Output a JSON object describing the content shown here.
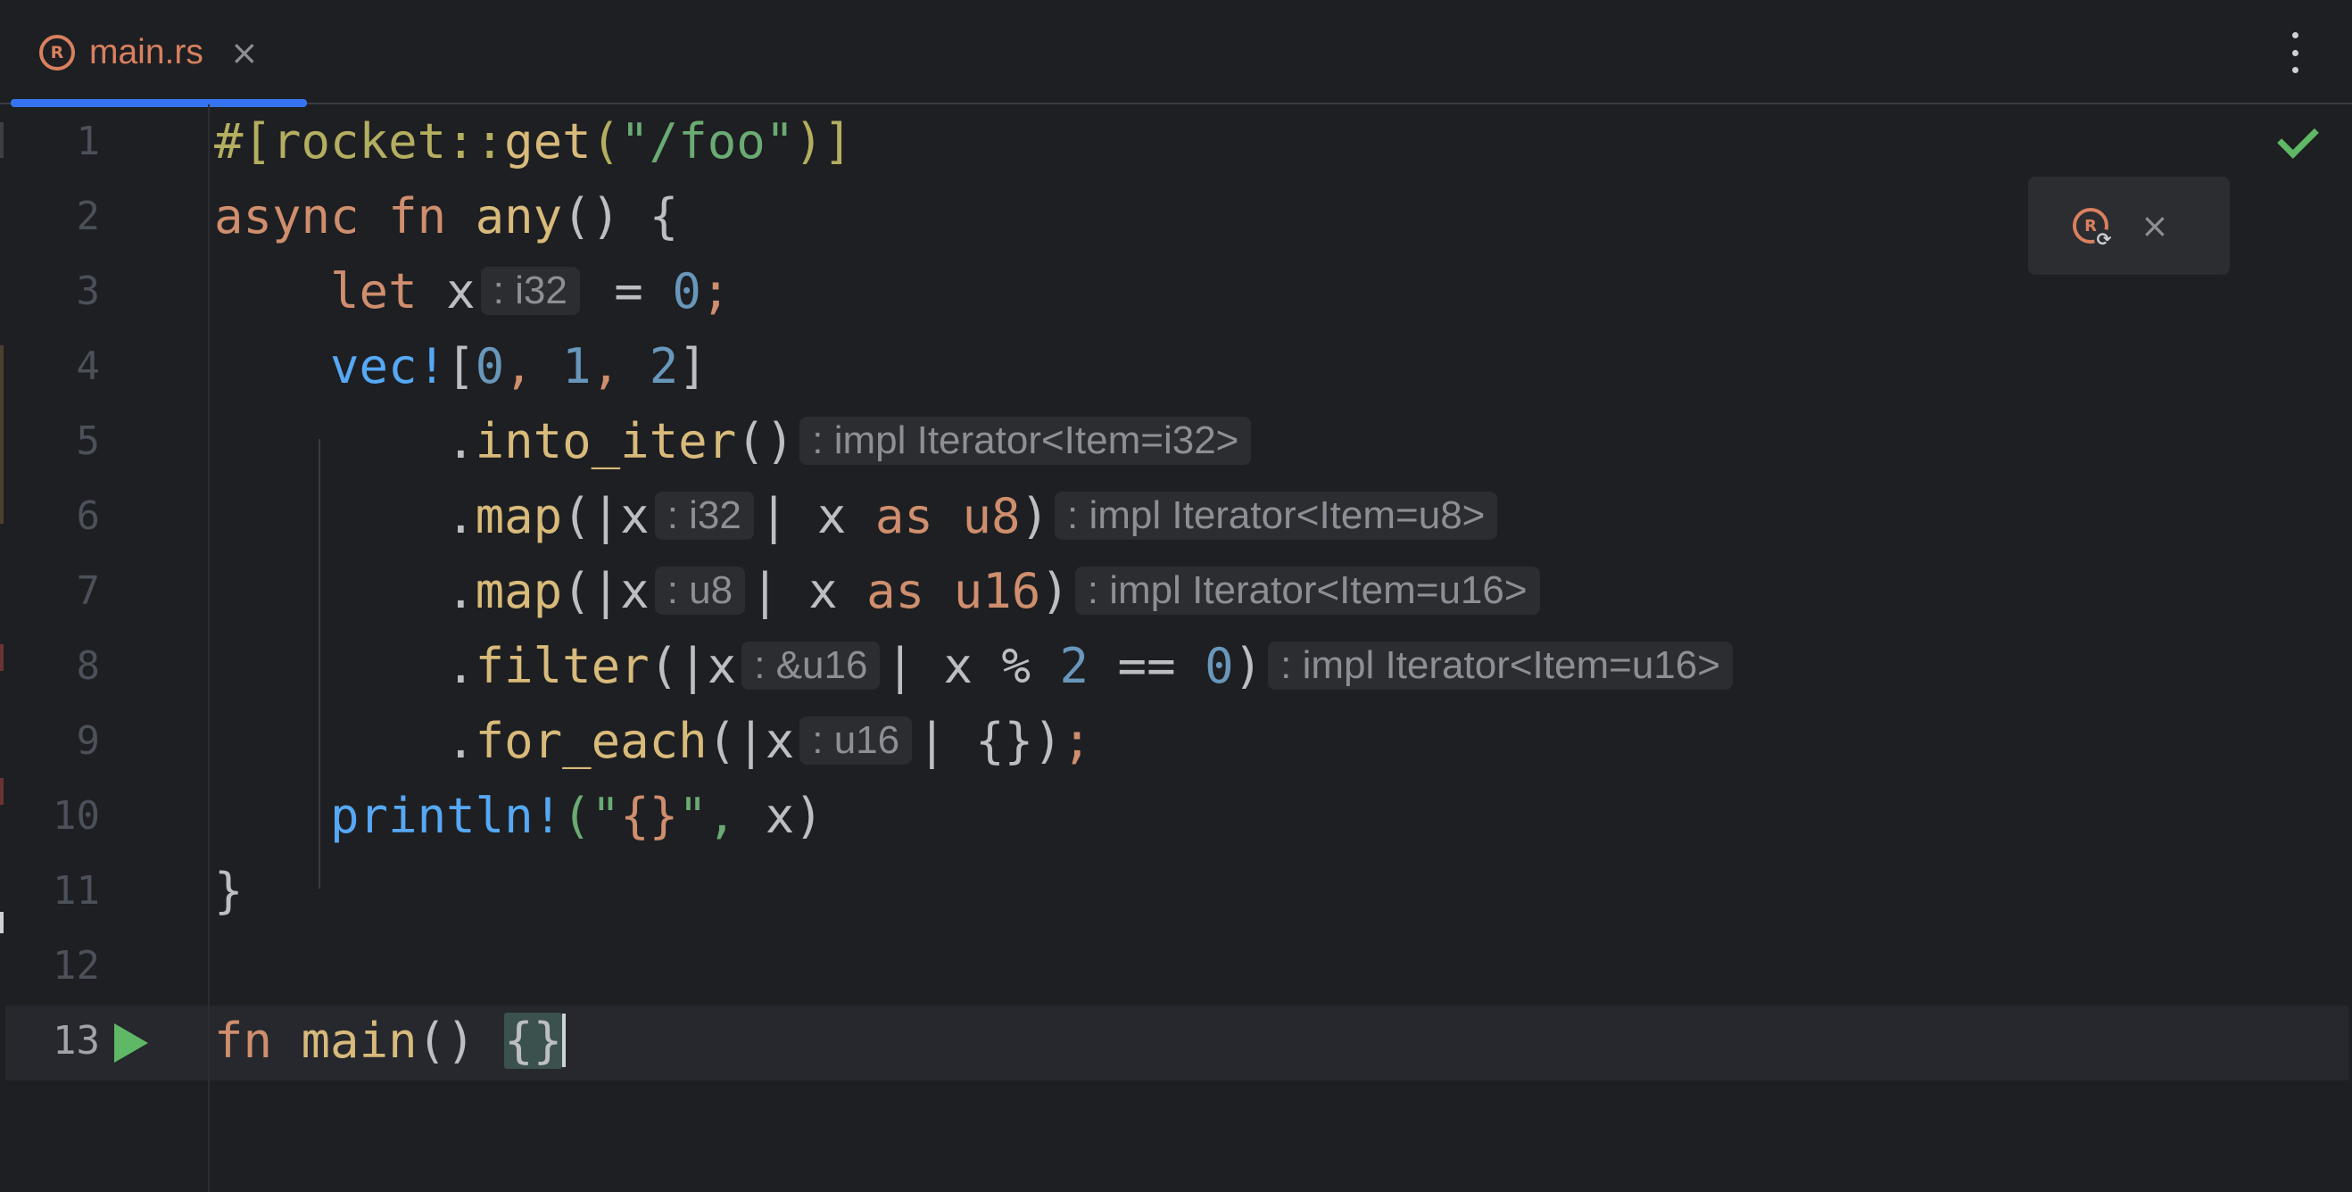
{
  "tab": {
    "filename": "main.rs",
    "close_symbol": "×",
    "icon": "rust-file-icon",
    "icon_glyph": "R"
  },
  "toolbar": {
    "more_menu_icon": "vertical-ellipsis-icon"
  },
  "popup": {
    "icon": "rust-reload-icon",
    "icon_glyph": "R",
    "sync_glyph": "⟳",
    "close_symbol": "×"
  },
  "inspection_status": "check-icon",
  "colors": {
    "background": "#1e1f22",
    "accent": "#3574f0",
    "keyword": "#cf8e6d",
    "function": "#d8ba7a",
    "macro": "#56a8f5",
    "number": "#6897bb",
    "string": "#6aab73",
    "hint_bg": "#2b2d30",
    "run_green": "#5fb865"
  },
  "editor": {
    "line_numbers": [
      "1",
      "2",
      "3",
      "4",
      "5",
      "6",
      "7",
      "8",
      "9",
      "10",
      "11",
      "12",
      "13"
    ],
    "active_line": 13,
    "code": {
      "l1": {
        "attr_open": "#[rocket::",
        "attr_fn": "get",
        "paren_open": "(",
        "str": "\"/foo\"",
        "attr_close": ")]"
      },
      "l2": {
        "kw_async": "async",
        "kw_fn": "fn",
        "name": "any",
        "rest": "() {"
      },
      "l3": {
        "kw_let": "let",
        "var": "x",
        "hint": ": i32",
        "eq": " = ",
        "num": "0",
        "semi": ";"
      },
      "l4": {
        "macro": "vec!",
        "open": "[",
        "n0": "0",
        "c1": ", ",
        "n1": "1",
        "c2": ", ",
        "n2": "2",
        "close": "]"
      },
      "l5": {
        "dot": ".",
        "method": "into_iter",
        "parens": "()",
        "hint": ": impl Iterator<Item=i32>"
      },
      "l6": {
        "dot": ".",
        "method": "map",
        "open": "(|x",
        "hint_param": ": i32",
        "mid": "| x ",
        "kw_as": "as",
        "type": "u8",
        "close": ")",
        "hint": ": impl Iterator<Item=u8>"
      },
      "l7": {
        "dot": ".",
        "method": "map",
        "open": "(|x",
        "hint_param": ": u8",
        "mid": "| x ",
        "kw_as": "as",
        "type": "u16",
        "close": ")",
        "hint": ": impl Iterator<Item=u16>"
      },
      "l8": {
        "dot": ".",
        "method": "filter",
        "open": "(|x",
        "hint_param": ": &u16",
        "mid": "| x % ",
        "num_a": "2",
        "eqeq": " == ",
        "num_b": "0",
        "close": ")",
        "hint": ": impl Iterator<Item=u16>"
      },
      "l9": {
        "dot": ".",
        "method": "for_each",
        "open": "(|x",
        "hint_param": ": u16",
        "mid": "| {})",
        "semi": ";"
      },
      "l10": {
        "macro": "println!",
        "open": "(\"",
        "fmt": "{}",
        "mid": "\", ",
        "var": "x",
        "close": ")"
      },
      "l11": {
        "brace": "}"
      },
      "l12": {},
      "l13": {
        "kw_fn": "fn",
        "name": "main",
        "parens": "() ",
        "braces": "{}"
      }
    }
  }
}
